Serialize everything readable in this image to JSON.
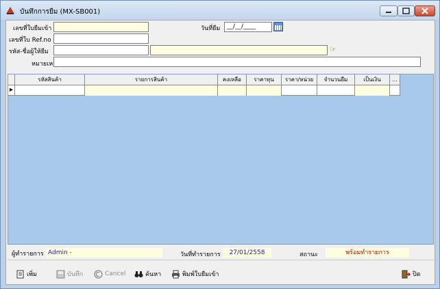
{
  "window": {
    "title": "บันทึกการยืม (MX-SB001)"
  },
  "form": {
    "doc_no_label": "เลขที่ใบยืมเข้า",
    "doc_no_value": "",
    "date_label": "วันที่ยืม",
    "date_value": "__/__/____",
    "ref_label": "เลขที่ใบ Ref.no",
    "ref_value": "",
    "lender_label": "รหัส-ชื่อผู้ให้ยืม",
    "lender_code": "",
    "lender_name": "",
    "remark_label": "หมายเหตุ",
    "remark_value": ""
  },
  "grid": {
    "columns": [
      "รหัสสินค้า",
      "รายการสินค้า",
      "คงเหลือ",
      "ราคาทุน",
      "ราคา/หน่วย",
      "จำนวนยืม",
      "เป็นเงิน",
      "..."
    ],
    "row_marker": "▸"
  },
  "status_bar": {
    "user_label": "ผู้ทำรายการ",
    "user_value": "Admin -",
    "date_label": "วันที่ทำรายการ",
    "date_value": "27/01/2558",
    "state_label": "สถานะ",
    "state_value": "พร้อมทำรายการ",
    "state_color": "#e00000",
    "value_color": "#1a1aa8"
  },
  "toolbar": {
    "add_label": "เพิ่ม",
    "save_label": "บันทึก",
    "cancel_label": "Cancel",
    "search_label": "ค้นหา",
    "print_label": "พิมพ์ใบยืมเข้า",
    "close_label": "ปิด"
  },
  "icons": [
    "app-icon",
    "minimize-icon",
    "maximize-icon",
    "close-icon",
    "calendar-icon",
    "lookup-icon",
    "add-doc-icon",
    "save-icon",
    "cancel-icon",
    "binoculars-icon",
    "printer-icon",
    "exit-icon"
  ]
}
